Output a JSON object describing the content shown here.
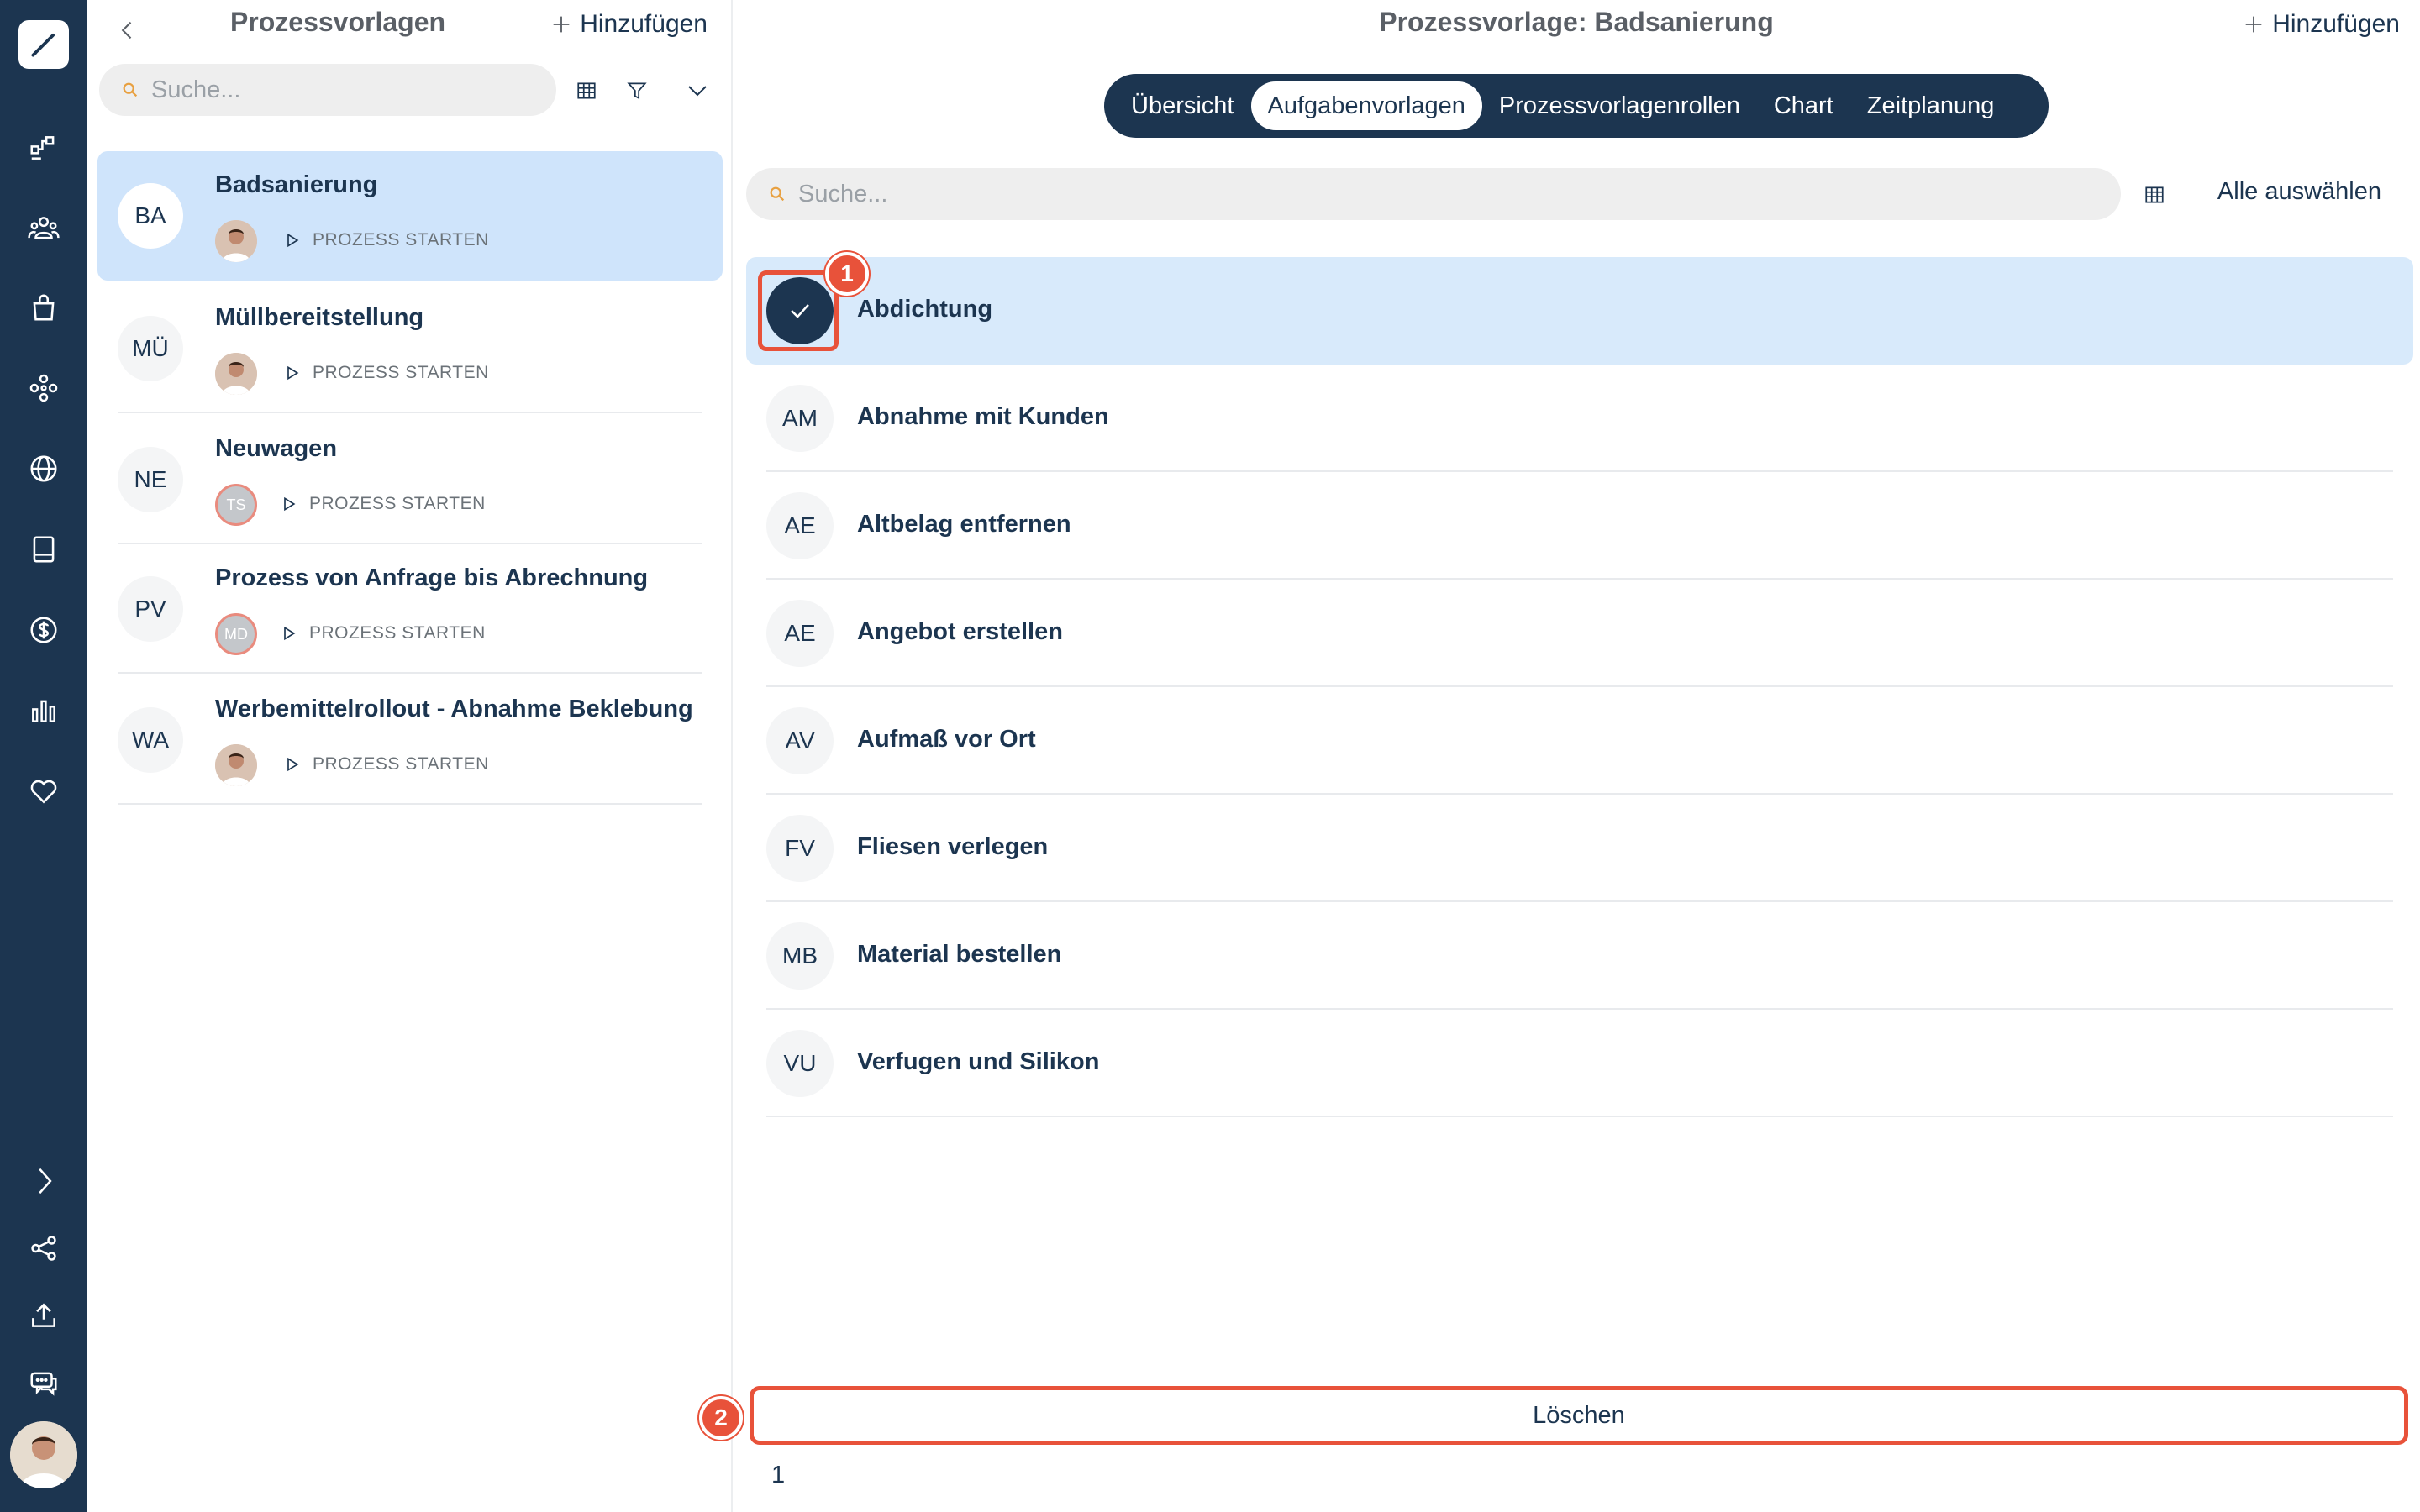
{
  "list_panel": {
    "title": "Prozessvorlagen",
    "add_label": "Hinzufügen",
    "search_placeholder": "Suche...",
    "templates": [
      {
        "initials": "BA",
        "name": "Badsanierung",
        "start_label": "PROZESS STARTEN",
        "owner": "photo"
      },
      {
        "initials": "MÜ",
        "name": "Müllbereitstellung",
        "start_label": "PROZESS STARTEN",
        "owner": "photo"
      },
      {
        "initials": "NE",
        "name": "Neuwagen",
        "start_label": "PROZESS STARTEN",
        "owner": "TS"
      },
      {
        "initials": "PV",
        "name": "Prozess von Anfrage bis Abrechnung",
        "start_label": "PROZESS STARTEN",
        "owner": "MD"
      },
      {
        "initials": "WA",
        "name": "Werbemittelrollout - Abnahme Beklebung",
        "start_label": "PROZESS STARTEN",
        "owner": "photo"
      }
    ]
  },
  "main": {
    "title": "Prozessvorlage: Badsanierung",
    "add_label": "Hinzufügen",
    "tabs": [
      "Übersicht",
      "Aufgabenvorlagen",
      "Prozessvorlagenrollen",
      "Chart",
      "Zeitplanung"
    ],
    "active_tab": "Aufgabenvorlagen",
    "search_placeholder": "Suche...",
    "select_all_label": "Alle auswählen",
    "tasks": [
      {
        "initials": "",
        "name": "Abdichtung",
        "selected": true
      },
      {
        "initials": "AM",
        "name": "Abnahme mit Kunden",
        "selected": false
      },
      {
        "initials": "AE",
        "name": "Altbelag entfernen",
        "selected": false
      },
      {
        "initials": "AE",
        "name": "Angebot erstellen",
        "selected": false
      },
      {
        "initials": "AV",
        "name": "Aufmaß vor Ort",
        "selected": false
      },
      {
        "initials": "FV",
        "name": "Fliesen verlegen",
        "selected": false
      },
      {
        "initials": "MB",
        "name": "Material bestellen",
        "selected": false
      },
      {
        "initials": "VU",
        "name": "Verfugen und Silikon",
        "selected": false
      }
    ],
    "delete_label": "Löschen",
    "selected_count": "1"
  },
  "annotations": {
    "step1": "1",
    "step2": "2"
  },
  "colors": {
    "navy": "#1c3550",
    "selection": "#cfe4fb",
    "highlight": "#e8523a"
  },
  "rail_icons": [
    "logo-pen-icon",
    "process-icon",
    "people-icon",
    "shopping-bag-icon",
    "network-icon",
    "globe-icon",
    "book-icon",
    "dollar-icon",
    "bar-chart-icon",
    "heart-icon",
    "chevron-right-icon",
    "share-icon",
    "upload-icon",
    "chat-icon"
  ]
}
